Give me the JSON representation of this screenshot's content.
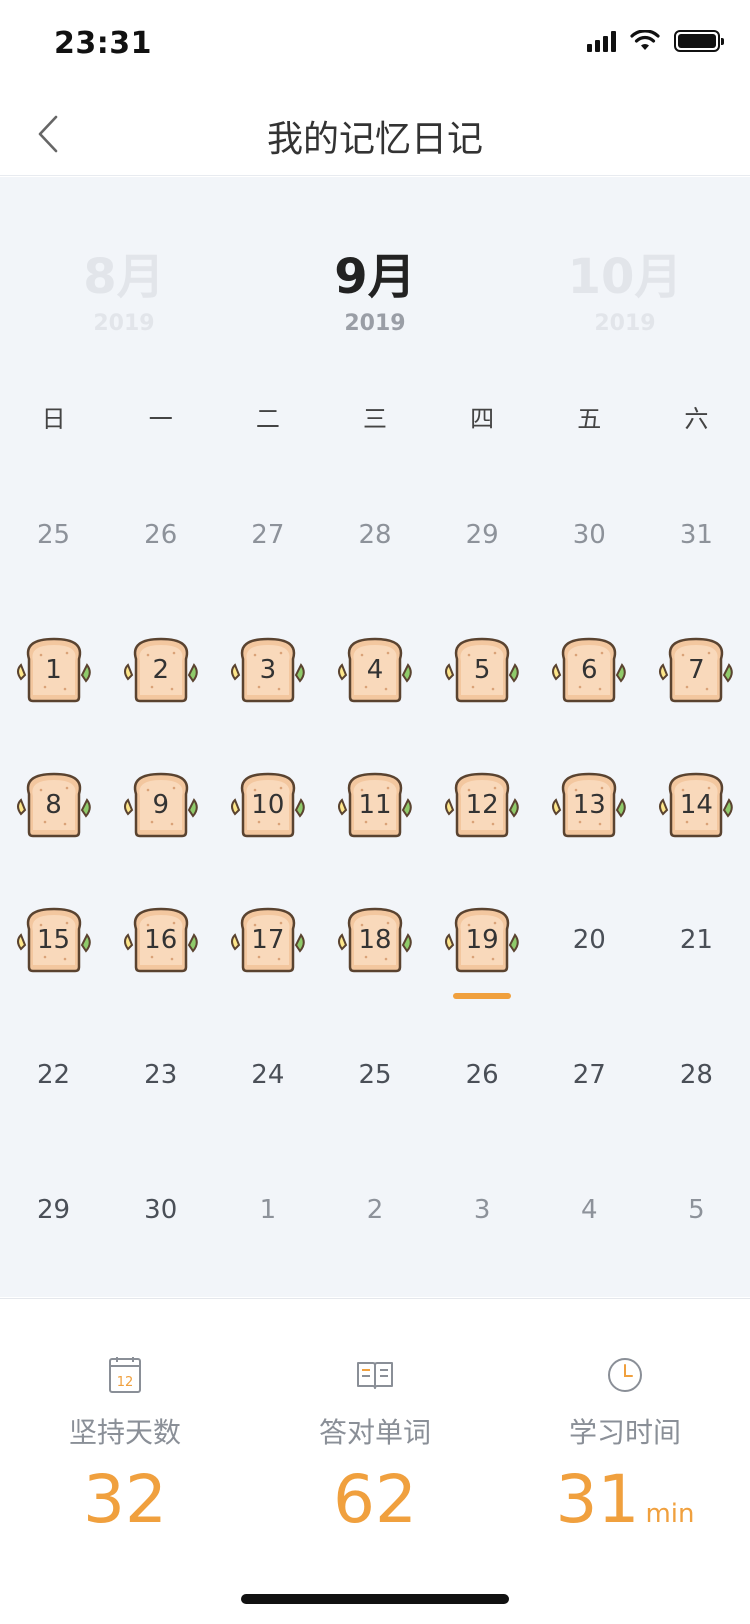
{
  "status_bar": {
    "time": "23:31"
  },
  "nav": {
    "title": "我的记忆日记"
  },
  "months": {
    "prev": {
      "name": "8月",
      "year": "2019"
    },
    "current": {
      "name": "9月",
      "year": "2019"
    },
    "next": {
      "name": "10月",
      "year": "2019"
    }
  },
  "weekdays": [
    "日",
    "一",
    "二",
    "三",
    "四",
    "五",
    "六"
  ],
  "weeks": [
    [
      {
        "d": "25",
        "s": "other"
      },
      {
        "d": "26",
        "s": "other"
      },
      {
        "d": "27",
        "s": "other"
      },
      {
        "d": "28",
        "s": "other"
      },
      {
        "d": "29",
        "s": "other"
      },
      {
        "d": "30",
        "s": "other"
      },
      {
        "d": "31",
        "s": "other"
      }
    ],
    [
      {
        "d": "1",
        "s": "done"
      },
      {
        "d": "2",
        "s": "done"
      },
      {
        "d": "3",
        "s": "done"
      },
      {
        "d": "4",
        "s": "done"
      },
      {
        "d": "5",
        "s": "done"
      },
      {
        "d": "6",
        "s": "done"
      },
      {
        "d": "7",
        "s": "done"
      }
    ],
    [
      {
        "d": "8",
        "s": "done"
      },
      {
        "d": "9",
        "s": "done"
      },
      {
        "d": "10",
        "s": "done"
      },
      {
        "d": "11",
        "s": "done"
      },
      {
        "d": "12",
        "s": "done"
      },
      {
        "d": "13",
        "s": "done"
      },
      {
        "d": "14",
        "s": "done"
      }
    ],
    [
      {
        "d": "15",
        "s": "done"
      },
      {
        "d": "16",
        "s": "done"
      },
      {
        "d": "17",
        "s": "done"
      },
      {
        "d": "18",
        "s": "done"
      },
      {
        "d": "19",
        "s": "today"
      },
      {
        "d": "20",
        "s": "normal"
      },
      {
        "d": "21",
        "s": "normal"
      }
    ],
    [
      {
        "d": "22",
        "s": "normal"
      },
      {
        "d": "23",
        "s": "normal"
      },
      {
        "d": "24",
        "s": "normal"
      },
      {
        "d": "25",
        "s": "normal"
      },
      {
        "d": "26",
        "s": "normal"
      },
      {
        "d": "27",
        "s": "normal"
      },
      {
        "d": "28",
        "s": "normal"
      }
    ],
    [
      {
        "d": "29",
        "s": "normal"
      },
      {
        "d": "30",
        "s": "normal"
      },
      {
        "d": "1",
        "s": "other"
      },
      {
        "d": "2",
        "s": "other"
      },
      {
        "d": "3",
        "s": "other"
      },
      {
        "d": "4",
        "s": "other"
      },
      {
        "d": "5",
        "s": "other"
      }
    ]
  ],
  "stats": {
    "streak": {
      "label": "坚持天数",
      "value": "32",
      "icon": "calendar-icon",
      "icon_text": "12"
    },
    "words": {
      "label": "答对单词",
      "value": "62",
      "icon": "book-icon"
    },
    "time": {
      "label": "学习时间",
      "value": "31",
      "unit": "min",
      "icon": "clock-icon"
    }
  },
  "colors": {
    "accent": "#f0a03e",
    "calendar_bg": "#f2f5f9"
  }
}
